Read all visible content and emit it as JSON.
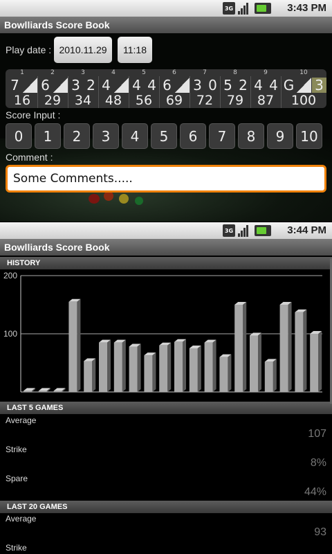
{
  "status_top": {
    "time": "3:43 PM",
    "net": "3G"
  },
  "status_bottom": {
    "time": "3:44 PM",
    "net": "3G"
  },
  "app_title": "Bowlliards Score Book",
  "play_date": {
    "label": "Play date :",
    "date": "2010.11.29",
    "time": "11:18"
  },
  "frames": [
    {
      "no": "1",
      "rolls": [
        "7",
        "/"
      ],
      "score": "16"
    },
    {
      "no": "2",
      "rolls": [
        "6",
        "/"
      ],
      "score": "29"
    },
    {
      "no": "3",
      "rolls": [
        "3",
        "2"
      ],
      "score": "34"
    },
    {
      "no": "4",
      "rolls": [
        "4",
        "/"
      ],
      "score": "48"
    },
    {
      "no": "5",
      "rolls": [
        "4",
        "4"
      ],
      "score": "56"
    },
    {
      "no": "6",
      "rolls": [
        "6",
        "/"
      ],
      "score": "69"
    },
    {
      "no": "7",
      "rolls": [
        "3",
        "0"
      ],
      "score": "72"
    },
    {
      "no": "8",
      "rolls": [
        "5",
        "2"
      ],
      "score": "79"
    },
    {
      "no": "9",
      "rolls": [
        "4",
        "4"
      ],
      "score": "87"
    },
    {
      "no": "10",
      "rolls": [
        "G",
        "/",
        "3"
      ],
      "score": "100"
    }
  ],
  "score_input": {
    "label": "Score Input :",
    "keys": [
      "0",
      "1",
      "2",
      "3",
      "4",
      "5",
      "6",
      "7",
      "8",
      "9",
      "10"
    ]
  },
  "comment": {
    "label": "Comment :",
    "value": "Some Comments....."
  },
  "history": {
    "header": "HISTORY"
  },
  "chart_data": {
    "type": "bar",
    "ylim": [
      0,
      200
    ],
    "yticks": [
      "200",
      "100"
    ],
    "values": [
      2,
      2,
      2,
      155,
      53,
      85,
      85,
      78,
      63,
      80,
      86,
      75,
      85,
      60,
      150,
      97,
      52,
      150,
      137,
      100
    ]
  },
  "last5": {
    "header": "LAST 5 GAMES",
    "average_label": "Average",
    "average": "107",
    "strike_label": "Strike",
    "strike": "8%",
    "spare_label": "Spare",
    "spare": "44%"
  },
  "last20": {
    "header": "LAST 20 GAMES",
    "average_label": "Average",
    "average": "93",
    "strike_label": "Strike"
  }
}
